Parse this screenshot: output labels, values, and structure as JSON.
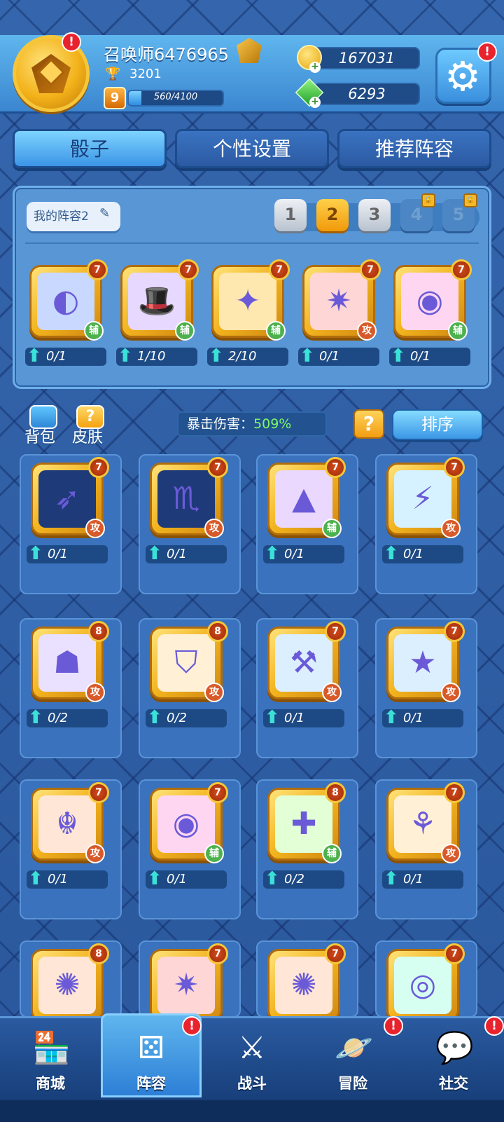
{
  "header": {
    "username": "召唤师6476965",
    "trophies": "3201",
    "level": "9",
    "xp_text": "560/4100",
    "xp_fraction": 0.1366,
    "gold": "167031",
    "gems": "6293"
  },
  "tabs": [
    {
      "label": "骰子",
      "active": true
    },
    {
      "label": "个性设置",
      "active": false
    },
    {
      "label": "推荐阵容",
      "active": false
    }
  ],
  "lineup": {
    "name": "我的阵容2",
    "slots": [
      {
        "label": "1",
        "state": "normal"
      },
      {
        "label": "2",
        "state": "active"
      },
      {
        "label": "3",
        "state": "normal"
      },
      {
        "label": "4",
        "state": "locked"
      },
      {
        "label": "5",
        "state": "locked"
      }
    ],
    "dice": [
      {
        "level": "7",
        "role": "辅",
        "progress": "0/1",
        "icon": "mask-icon",
        "art": "#c9d8ff"
      },
      {
        "level": "7",
        "role": "辅",
        "progress": "1/10",
        "icon": "magic-hat-icon",
        "art": "#e6d8ff"
      },
      {
        "level": "7",
        "role": "辅",
        "progress": "2/10",
        "icon": "puzzle-icon",
        "art": "#ffe7b0"
      },
      {
        "level": "7",
        "role": "攻",
        "progress": "0/1",
        "icon": "shuriken-icon",
        "art": "#ffd6d6"
      },
      {
        "level": "7",
        "role": "辅",
        "progress": "0/1",
        "icon": "eye-icon",
        "art": "#ffd6f2"
      }
    ]
  },
  "controls": {
    "backpack": "背包",
    "skin": "皮肤",
    "crit_label": "暴击伤害：",
    "crit_value": "509%",
    "sort": "排序"
  },
  "collection": [
    {
      "level": "7",
      "role": "攻",
      "progress": "0/1",
      "icon": "bow-icon",
      "art": "#1e3a78"
    },
    {
      "level": "7",
      "role": "攻",
      "progress": "0/1",
      "icon": "scorpion-icon",
      "art": "#1e3a78"
    },
    {
      "level": "7",
      "role": "辅",
      "progress": "0/1",
      "icon": "witch-hat-icon",
      "art": "#ead8ff"
    },
    {
      "level": "7",
      "role": "攻",
      "progress": "0/1",
      "icon": "lightning-icon",
      "art": "#d6f1ff"
    },
    {
      "level": "8",
      "role": "攻",
      "progress": "0/2",
      "icon": "ghost-icon",
      "art": "#eae0ff"
    },
    {
      "level": "8",
      "role": "攻",
      "progress": "0/2",
      "icon": "shield-icon",
      "art": "#fff0d6"
    },
    {
      "level": "7",
      "role": "攻",
      "progress": "0/1",
      "icon": "hammer-icon",
      "art": "#dcefff"
    },
    {
      "level": "7",
      "role": "攻",
      "progress": "0/1",
      "icon": "star-icon",
      "art": "#dcefff"
    },
    {
      "level": "7",
      "role": "攻",
      "progress": "0/1",
      "icon": "dragon-icon",
      "art": "#ffe6d6"
    },
    {
      "level": "7",
      "role": "辅",
      "progress": "0/1",
      "icon": "eye-icon",
      "art": "#ffd6f2"
    },
    {
      "level": "8",
      "role": "辅",
      "progress": "0/2",
      "icon": "plus-icon",
      "art": "#e2ffd6"
    },
    {
      "level": "7",
      "role": "攻",
      "progress": "0/1",
      "icon": "claw-icon",
      "art": "#fff0d6"
    },
    {
      "level": "8",
      "role": "",
      "progress": "",
      "icon": "fox-icon",
      "art": "#ffe6d6"
    },
    {
      "level": "7",
      "role": "",
      "progress": "",
      "icon": "shuriken-icon",
      "art": "#ffd6d6"
    },
    {
      "level": "7",
      "role": "",
      "progress": "",
      "icon": "fox-icon",
      "art": "#ffe6d6"
    },
    {
      "level": "7",
      "role": "",
      "progress": "",
      "icon": "ring-icon",
      "art": "#d6fff2"
    }
  ],
  "nav": [
    {
      "label": "商城",
      "icon": "shop-icon",
      "active": false,
      "badge": false
    },
    {
      "label": "阵容",
      "icon": "dice-icon",
      "active": true,
      "badge": true
    },
    {
      "label": "战斗",
      "icon": "swords-icon",
      "active": false,
      "badge": false
    },
    {
      "label": "冒险",
      "icon": "planet-icon",
      "active": false,
      "badge": true
    },
    {
      "label": "社交",
      "icon": "chat-icon",
      "active": false,
      "badge": true
    }
  ],
  "colors": {
    "atk": "#d85a2a",
    "sup": "#4db14e",
    "crit": "#7ef86a"
  }
}
